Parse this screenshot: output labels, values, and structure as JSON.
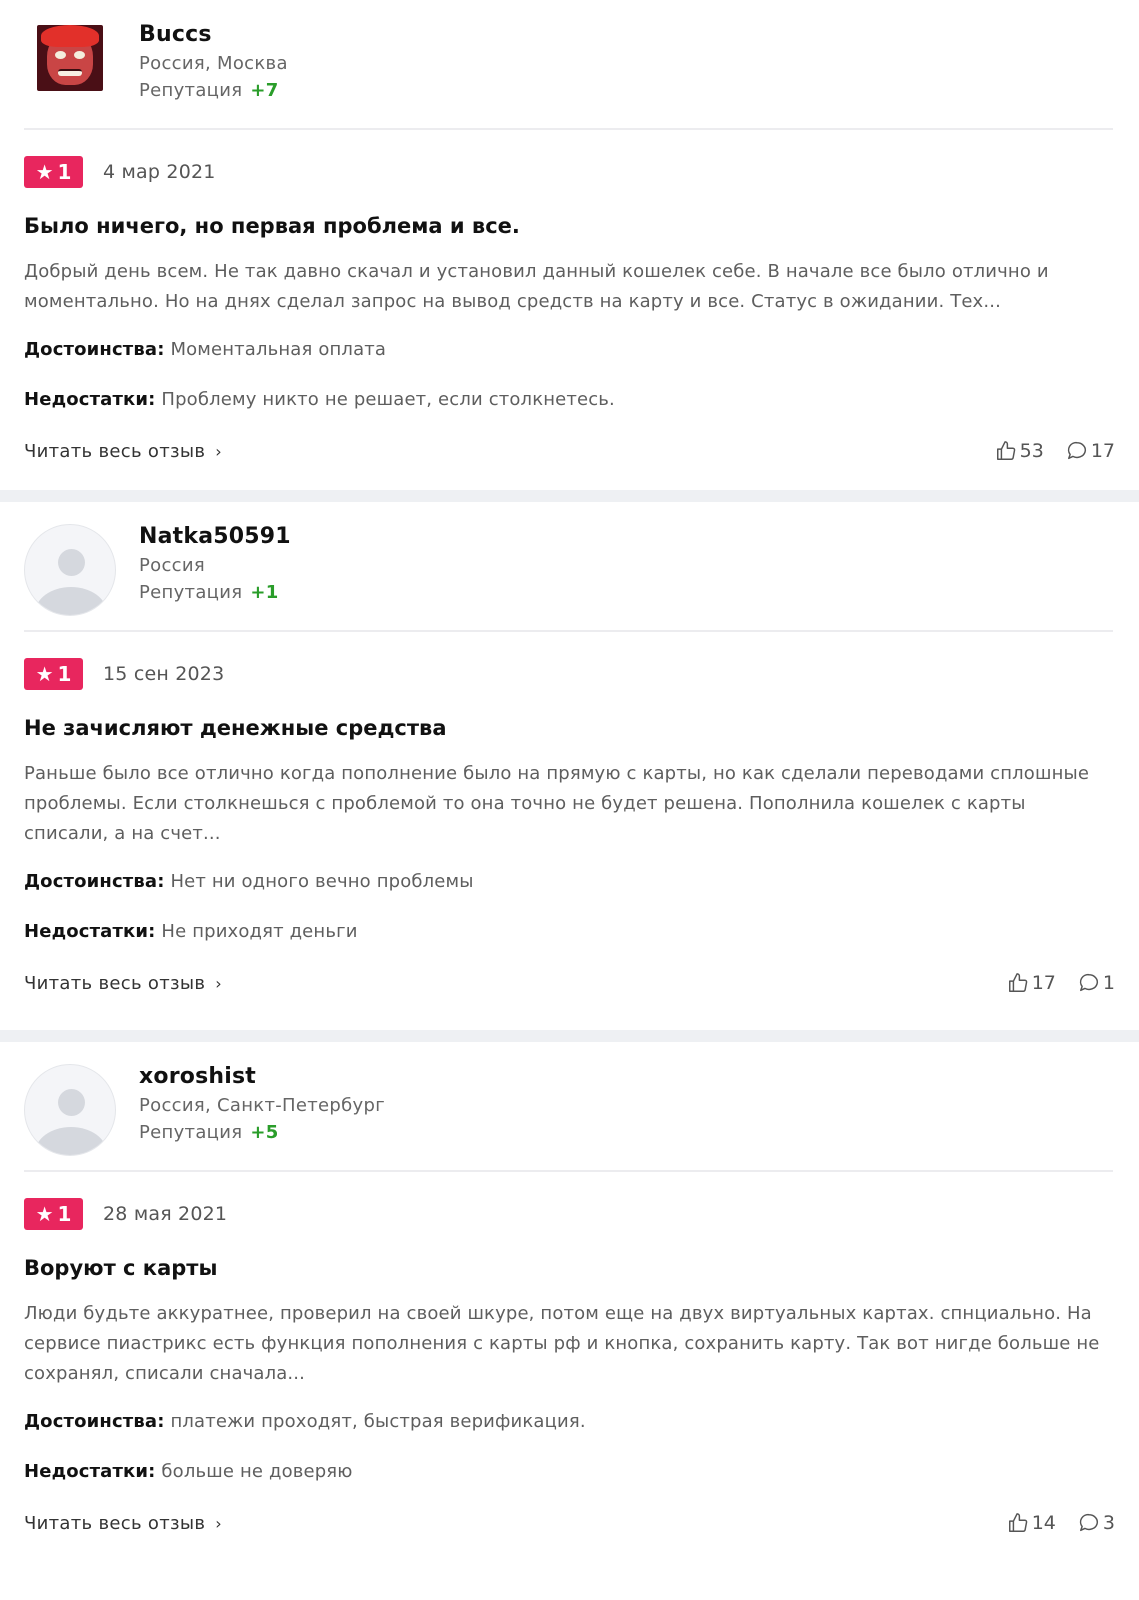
{
  "reviews": [
    {
      "username": "Buccs",
      "location": "Россия, Москва",
      "reputation_label": "Репутация",
      "reputation_value": "+7",
      "rating": "1",
      "date": "4 мар 2021",
      "title": "Было ничего, но первая проблема и все.",
      "excerpt": "Добрый день всем. Не так давно скачал и установил данный кошелек себе. В начале все было отлично и моментально. Но на днях сделал запрос на вывод средств на карту и все. Статус в ожидании. Тех...",
      "pros_label": "Достоинства:",
      "pros": "Моментальная оплата",
      "cons_label": "Недостатки:",
      "cons": "Проблему никто не решает, если столкнетесь.",
      "read_more": "Читать весь отзыв",
      "likes": "53",
      "comments": "17"
    },
    {
      "username": "Natka50591",
      "location": "Россия",
      "reputation_label": "Репутация",
      "reputation_value": "+1",
      "rating": "1",
      "date": "15 сен 2023",
      "title": "Не зачисляют денежные средства",
      "excerpt": "Раньше было все отлично когда пополнение было на прямую с карты, но как сделали переводами сплошные проблемы. Если столкнешься с проблемой то она точно не будет решена. Пополнила кошелек с карты списали, а на счет...",
      "pros_label": "Достоинства:",
      "pros": "Нет ни одного вечно проблемы",
      "cons_label": "Недостатки:",
      "cons": "Не приходят деньги",
      "read_more": "Читать весь отзыв",
      "likes": "17",
      "comments": "1"
    },
    {
      "username": "xoroshist",
      "location": "Россия, Санкт-Петербург",
      "reputation_label": "Репутация",
      "reputation_value": "+5",
      "rating": "1",
      "date": "28 мая 2021",
      "title": "Воруют с карты",
      "excerpt": "Люди будьте аккуратнее, проверил на своей шкуре, потом еще на двух виртуальных картах. спнциально. На сервисе пиастрикс есть функция пополнения с карты рф и кнопка, сохранить карту. Так вот нигде больше не сохранял, списали сначала...",
      "pros_label": "Достоинства:",
      "pros": "платежи проходят, быстрая верификация.",
      "cons_label": "Недостатки:",
      "cons": "больше не доверяю",
      "read_more": "Читать весь отзыв",
      "likes": "14",
      "comments": "3"
    }
  ],
  "icons": {
    "rating": "star-icon",
    "read_more": "chevron-right-icon",
    "likes": "thumbs-up-icon",
    "comments": "comment-icon"
  },
  "colors": {
    "rating_badge": "#e8265e",
    "reputation_positive": "#2a9d2a",
    "separator": "#eef0f3"
  }
}
